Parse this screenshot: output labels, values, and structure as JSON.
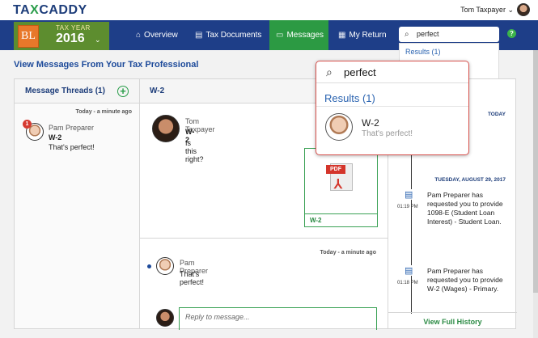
{
  "brand": {
    "logo_left": "TA",
    "logo_x": "X",
    "logo_right": "CADDY"
  },
  "user": {
    "name": "Tom Taxpayer",
    "chevron": "⌄"
  },
  "tax_year": {
    "badge": "BL",
    "label": "TAX YEAR",
    "year": "2016",
    "chevron": "⌄"
  },
  "nav": {
    "items": [
      {
        "label": "Overview",
        "icon": "⌂"
      },
      {
        "label": "Tax Documents",
        "icon": "▤"
      },
      {
        "label": "Messages",
        "icon": "▭"
      },
      {
        "label": "My Return",
        "icon": "▦"
      }
    ],
    "help": "?"
  },
  "search": {
    "value": "perfect",
    "results_label": "Results (1)"
  },
  "page_title": "View Messages From Your Tax Professional",
  "threads": {
    "header": "Message Threads (1)",
    "add": "+",
    "items": [
      {
        "time": "Today - a minute ago",
        "unread": "1",
        "name": "Pam Preparer",
        "subject": "W-2",
        "message": "That's perfect!"
      }
    ]
  },
  "conversation": {
    "header": "W-2",
    "messages": [
      {
        "name": "Tom Taxpayer",
        "subject": "W-2",
        "text": "Is this right?",
        "attachment_tag": "PDF",
        "attachment_symbol": "⅄",
        "attachment_label": "W-2"
      },
      {
        "time": "Today - a minute ago",
        "name": "Pam Preparer",
        "text": "That's perfect!"
      }
    ],
    "reply_placeholder": "Reply to message..."
  },
  "history": {
    "today_label": "TODAY",
    "date_label": "TUESDAY, AUGUST 29, 2017",
    "entries": [
      {
        "time": "01:19 PM",
        "text": "Pam Preparer has requested you to provide 1098-E (Student Loan Interest) - Student Loan."
      },
      {
        "time": "01:18 PM",
        "text": "Pam Preparer has requested you to provide W-2 (Wages) - Primary."
      }
    ],
    "view_full": "View Full History"
  },
  "zoom_popup": {
    "search_value": "perfect",
    "results_label": "Results (1)",
    "result": {
      "subject": "W-2",
      "message": "That's perfect!"
    }
  }
}
